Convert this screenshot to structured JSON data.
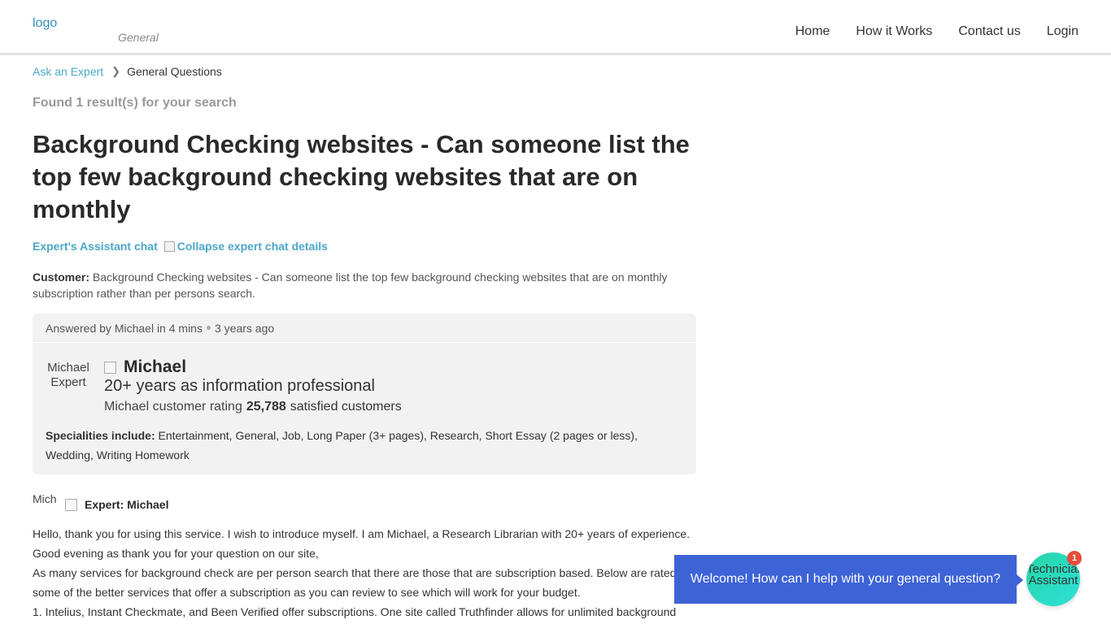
{
  "header": {
    "logo_alt": "logo",
    "category": "General",
    "nav": [
      "Home",
      "How it Works",
      "Contact us",
      "Login"
    ]
  },
  "breadcrumb": {
    "root": "Ask an Expert",
    "current": "General Questions"
  },
  "search_result_text": "Found 1 result(s) for your search",
  "question_title": "Background Checking websites - Can someone list the top few background checking websites that are on monthly",
  "chat_link": "Expert's Assistant chat",
  "collapse_alt": "Collapse expert chat details",
  "customer": {
    "label": "Customer:",
    "text": "Background Checking websites - Can someone list the top few background checking websites that are on monthly subscription rather than per persons search."
  },
  "answered": {
    "by": "Answered by Michael in 4 mins",
    "ago": "3 years ago"
  },
  "expert": {
    "avatar_alt": "Michael Expert",
    "name": "Michael",
    "description": "20+ years as information professional",
    "rating_alt": "Michael customer rating",
    "satisfied_count": "25,788",
    "satisfied_label": "satisfied customers",
    "specialities_label": "Specialities include:",
    "specialities": "Entertainment, General, Job, Long Paper (3+ pages), Research, Short Essay (2 pages or less), Wedding, Writing Homework"
  },
  "answer": {
    "avatar_alt": "Mich",
    "label": "Expert: Michael",
    "lines": [
      "Hello, thank you for using this service. I wish to introduce myself. I am Michael, a Research Librarian with 20+ years of experience.",
      "Good evening as thank you for your question on our site,",
      "As many services for background check are per person search that there are those that are subscription based.  Below are rated",
      "some of the better services that offer a subscription as you can review to see which will work for your budget.",
      "1.  Intelius, Instant Checkmate, and Been Verified offer subscriptions.  One site called Truthfinder allows for unlimited background"
    ]
  },
  "widget": {
    "welcome": "Welcome! How can I help with your general question?",
    "assistant_alt": "Technician Assistant",
    "badge": "1"
  },
  "colors": {
    "link": "#4aa7c9",
    "bubble": "#3d63d6",
    "assistant": "#2ee0d8",
    "badge": "#e74c3c"
  }
}
